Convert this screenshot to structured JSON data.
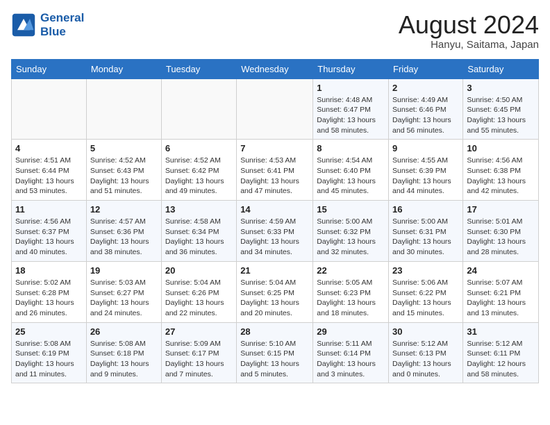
{
  "header": {
    "logo_line1": "General",
    "logo_line2": "Blue",
    "month_year": "August 2024",
    "location": "Hanyu, Saitama, Japan"
  },
  "weekdays": [
    "Sunday",
    "Monday",
    "Tuesday",
    "Wednesday",
    "Thursday",
    "Friday",
    "Saturday"
  ],
  "weeks": [
    [
      {
        "day": "",
        "info": ""
      },
      {
        "day": "",
        "info": ""
      },
      {
        "day": "",
        "info": ""
      },
      {
        "day": "",
        "info": ""
      },
      {
        "day": "1",
        "info": "Sunrise: 4:48 AM\nSunset: 6:47 PM\nDaylight: 13 hours\nand 58 minutes."
      },
      {
        "day": "2",
        "info": "Sunrise: 4:49 AM\nSunset: 6:46 PM\nDaylight: 13 hours\nand 56 minutes."
      },
      {
        "day": "3",
        "info": "Sunrise: 4:50 AM\nSunset: 6:45 PM\nDaylight: 13 hours\nand 55 minutes."
      }
    ],
    [
      {
        "day": "4",
        "info": "Sunrise: 4:51 AM\nSunset: 6:44 PM\nDaylight: 13 hours\nand 53 minutes."
      },
      {
        "day": "5",
        "info": "Sunrise: 4:52 AM\nSunset: 6:43 PM\nDaylight: 13 hours\nand 51 minutes."
      },
      {
        "day": "6",
        "info": "Sunrise: 4:52 AM\nSunset: 6:42 PM\nDaylight: 13 hours\nand 49 minutes."
      },
      {
        "day": "7",
        "info": "Sunrise: 4:53 AM\nSunset: 6:41 PM\nDaylight: 13 hours\nand 47 minutes."
      },
      {
        "day": "8",
        "info": "Sunrise: 4:54 AM\nSunset: 6:40 PM\nDaylight: 13 hours\nand 45 minutes."
      },
      {
        "day": "9",
        "info": "Sunrise: 4:55 AM\nSunset: 6:39 PM\nDaylight: 13 hours\nand 44 minutes."
      },
      {
        "day": "10",
        "info": "Sunrise: 4:56 AM\nSunset: 6:38 PM\nDaylight: 13 hours\nand 42 minutes."
      }
    ],
    [
      {
        "day": "11",
        "info": "Sunrise: 4:56 AM\nSunset: 6:37 PM\nDaylight: 13 hours\nand 40 minutes."
      },
      {
        "day": "12",
        "info": "Sunrise: 4:57 AM\nSunset: 6:36 PM\nDaylight: 13 hours\nand 38 minutes."
      },
      {
        "day": "13",
        "info": "Sunrise: 4:58 AM\nSunset: 6:34 PM\nDaylight: 13 hours\nand 36 minutes."
      },
      {
        "day": "14",
        "info": "Sunrise: 4:59 AM\nSunset: 6:33 PM\nDaylight: 13 hours\nand 34 minutes."
      },
      {
        "day": "15",
        "info": "Sunrise: 5:00 AM\nSunset: 6:32 PM\nDaylight: 13 hours\nand 32 minutes."
      },
      {
        "day": "16",
        "info": "Sunrise: 5:00 AM\nSunset: 6:31 PM\nDaylight: 13 hours\nand 30 minutes."
      },
      {
        "day": "17",
        "info": "Sunrise: 5:01 AM\nSunset: 6:30 PM\nDaylight: 13 hours\nand 28 minutes."
      }
    ],
    [
      {
        "day": "18",
        "info": "Sunrise: 5:02 AM\nSunset: 6:28 PM\nDaylight: 13 hours\nand 26 minutes."
      },
      {
        "day": "19",
        "info": "Sunrise: 5:03 AM\nSunset: 6:27 PM\nDaylight: 13 hours\nand 24 minutes."
      },
      {
        "day": "20",
        "info": "Sunrise: 5:04 AM\nSunset: 6:26 PM\nDaylight: 13 hours\nand 22 minutes."
      },
      {
        "day": "21",
        "info": "Sunrise: 5:04 AM\nSunset: 6:25 PM\nDaylight: 13 hours\nand 20 minutes."
      },
      {
        "day": "22",
        "info": "Sunrise: 5:05 AM\nSunset: 6:23 PM\nDaylight: 13 hours\nand 18 minutes."
      },
      {
        "day": "23",
        "info": "Sunrise: 5:06 AM\nSunset: 6:22 PM\nDaylight: 13 hours\nand 15 minutes."
      },
      {
        "day": "24",
        "info": "Sunrise: 5:07 AM\nSunset: 6:21 PM\nDaylight: 13 hours\nand 13 minutes."
      }
    ],
    [
      {
        "day": "25",
        "info": "Sunrise: 5:08 AM\nSunset: 6:19 PM\nDaylight: 13 hours\nand 11 minutes."
      },
      {
        "day": "26",
        "info": "Sunrise: 5:08 AM\nSunset: 6:18 PM\nDaylight: 13 hours\nand 9 minutes."
      },
      {
        "day": "27",
        "info": "Sunrise: 5:09 AM\nSunset: 6:17 PM\nDaylight: 13 hours\nand 7 minutes."
      },
      {
        "day": "28",
        "info": "Sunrise: 5:10 AM\nSunset: 6:15 PM\nDaylight: 13 hours\nand 5 minutes."
      },
      {
        "day": "29",
        "info": "Sunrise: 5:11 AM\nSunset: 6:14 PM\nDaylight: 13 hours\nand 3 minutes."
      },
      {
        "day": "30",
        "info": "Sunrise: 5:12 AM\nSunset: 6:13 PM\nDaylight: 13 hours\nand 0 minutes."
      },
      {
        "day": "31",
        "info": "Sunrise: 5:12 AM\nSunset: 6:11 PM\nDaylight: 12 hours\nand 58 minutes."
      }
    ]
  ]
}
